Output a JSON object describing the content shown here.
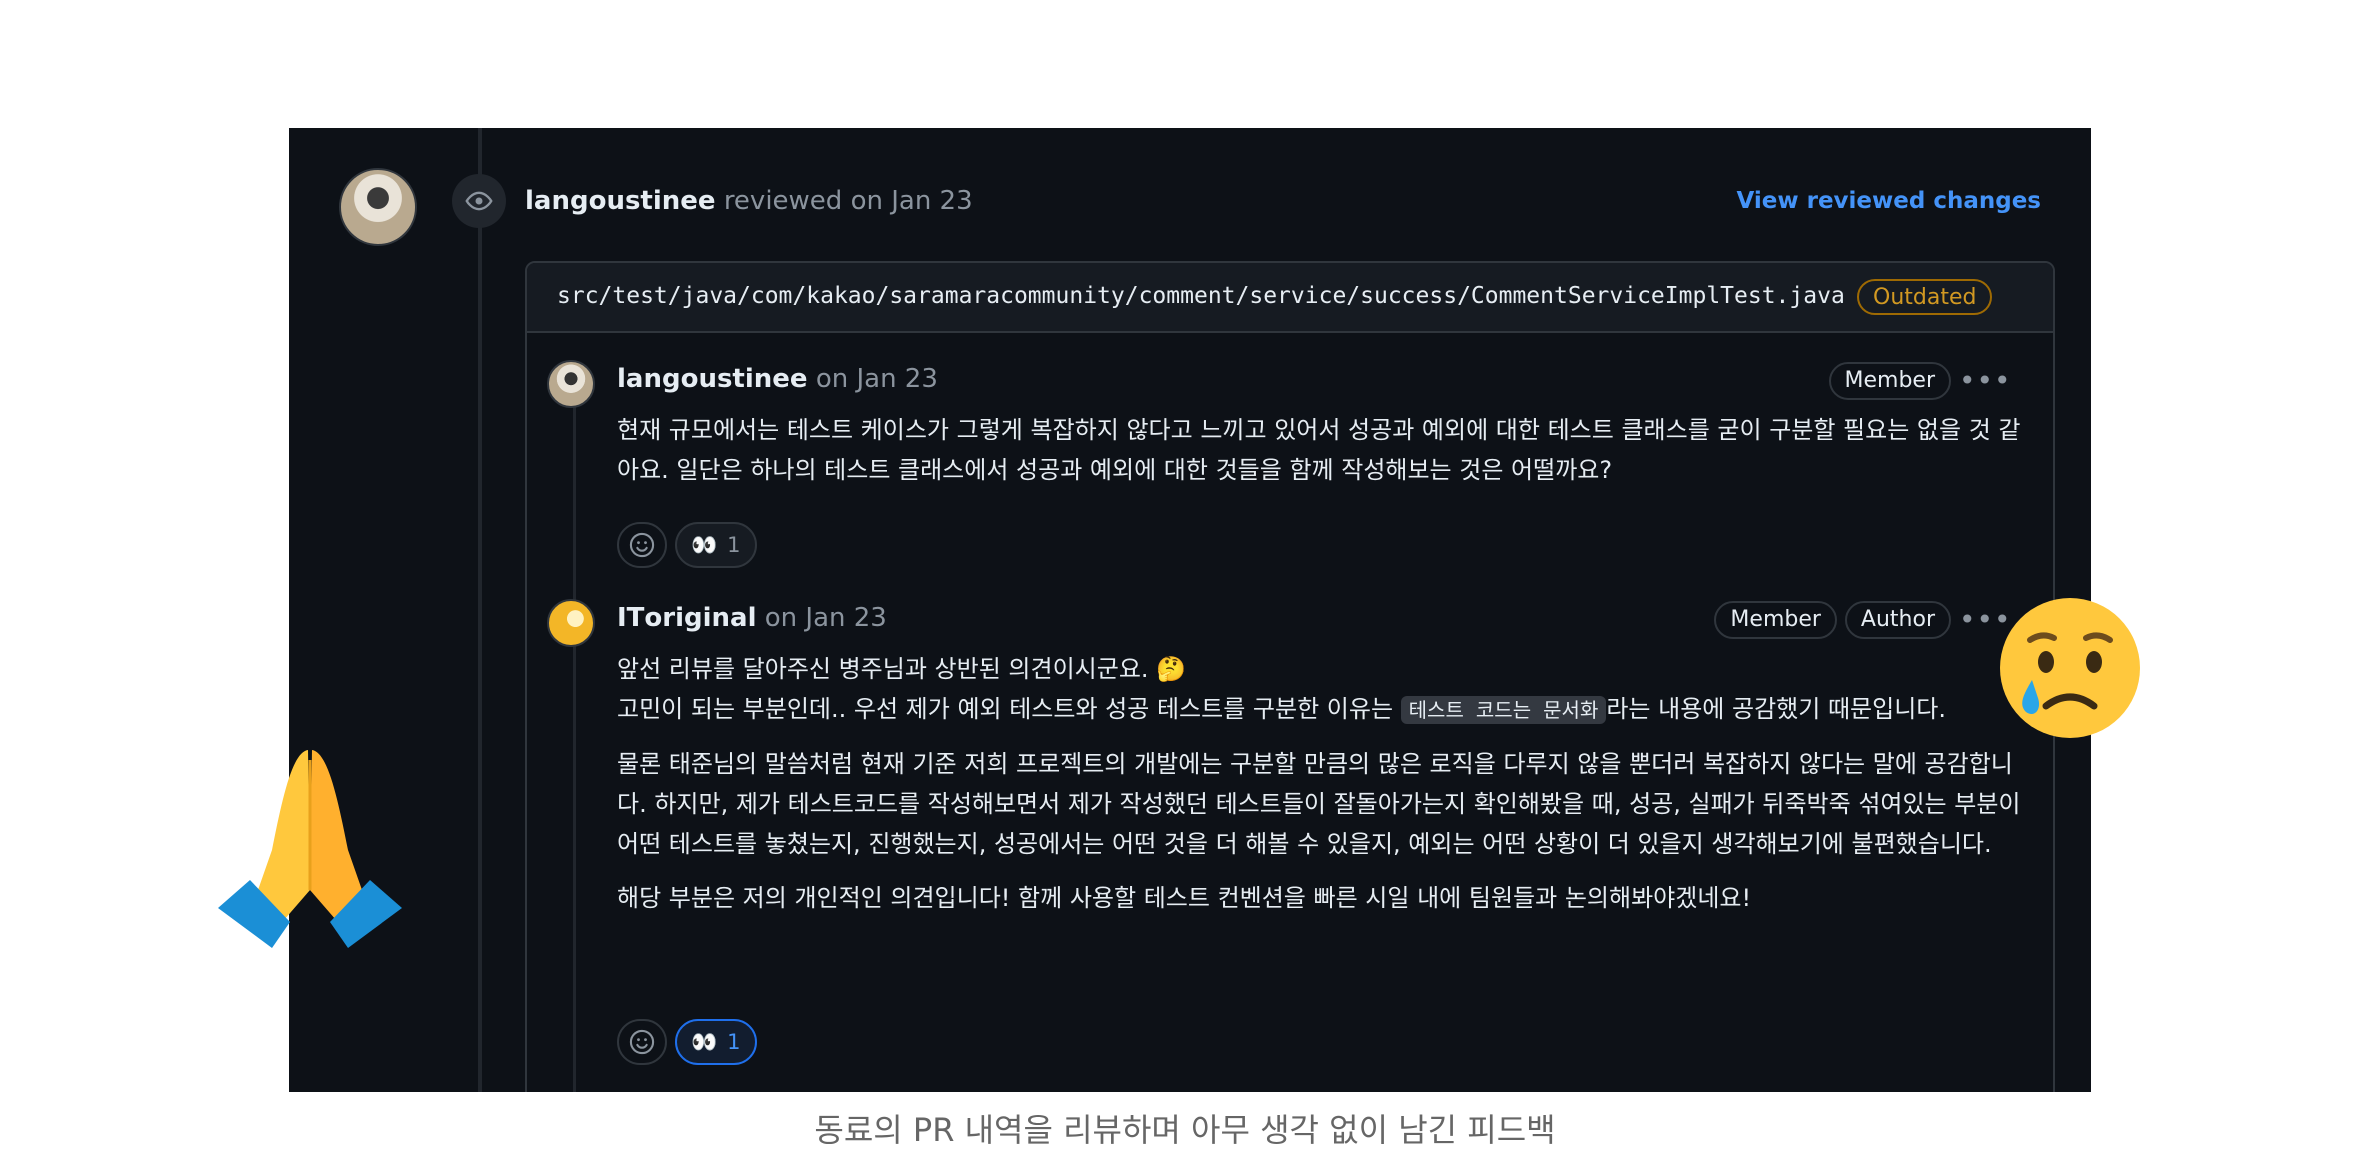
{
  "timeline": {
    "reviewer": "langoustinee",
    "action": "reviewed on Jan 23",
    "view_changes_label": "View reviewed changes"
  },
  "file": {
    "path": "src/test/java/com/kakao/saramaracommunity/comment/service/success/CommentServiceImplTest.java",
    "status_badge": "Outdated"
  },
  "comments": [
    {
      "author": "langoustinee",
      "date": "on Jan 23",
      "badges": [
        "Member"
      ],
      "more_icon": "kebab-horizontal-icon",
      "body": "현재 규모에서는 테스트 케이스가 그렇게 복잡하지 않다고 느끼고 있어서 성공과 예외에 대한 테스트 클래스를 굳이 구분할 필요는 없을 것 같아요. 일단은 하나의 테스트 클래스에서 성공과 예외에 대한 것들을 함께 작성해보는 것은 어떨까요?",
      "reaction": {
        "emoji": "👀",
        "count": "1"
      }
    },
    {
      "author": "ITоriginal",
      "date": "on Jan 23",
      "badges": [
        "Member",
        "Author"
      ],
      "more_icon": "kebab-horizontal-icon",
      "line1": "앞선 리뷰를 달아주신 병주님과 상반된 의견이시군요. 🤔",
      "line2_pre": "고민이 되는 부분인데.. 우선 제가 예외 테스트와 성공 테스트를 구분한 이유는 ",
      "line2_code": "테스트 코드는 문서화",
      "line2_post": "라는 내용에 공감했기 때문입니다.",
      "para2": "물론 태준님의 말씀처럼 현재 기준 저희 프로젝트의 개발에는 구분할 만큼의 많은 로직을 다루지 않을 뿐더러 복잡하지 않다는 말에 공감합니다. 하지만, 제가 테스트코드를 작성해보면서 제가 작성했던 테스트들이 잘돌아가는지 확인해봤을 때, 성공, 실패가 뒤죽박죽 섞여있는 부분이 어떤 테스트를 놓쳤는지, 진행했는지, 성공에서는 어떤 것을 더 해볼 수 있을지, 예외는 어떤 상황이 더 있을지 생각해보기에 불편했습니다.",
      "para3": "해당 부분은 저의 개인적인 의견입니다! 함께 사용할 테스트 컨벤션을 빠른 시일 내에 팀원들과 논의해봐야겠네요!",
      "reaction": {
        "emoji": "👀",
        "count": "1"
      }
    }
  ],
  "decorations": {
    "left_emoji": "🙏",
    "right_emoji": "😢"
  },
  "caption": "동료의 PR 내역을 리뷰하며 아무 생각 없이 남긴 피드백",
  "colors": {
    "panel_bg": "#0d1117",
    "link": "#4493f8",
    "outdated": "#d29922",
    "text": "#e6edf3",
    "muted": "#8b949e"
  }
}
